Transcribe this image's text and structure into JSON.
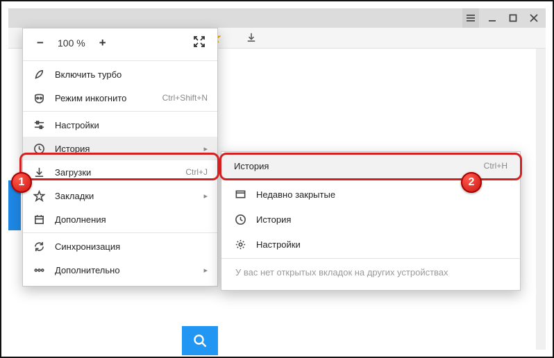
{
  "window": {
    "zoom": {
      "minus": "−",
      "value": "100 %",
      "plus": "+"
    }
  },
  "menu": {
    "turbo": "Включить турбо",
    "incognito": "Режим инкогнито",
    "incognito_sc": "Ctrl+Shift+N",
    "settings": "Настройки",
    "history": "История",
    "downloads": "Загрузки",
    "downloads_sc": "Ctrl+J",
    "bookmarks": "Закладки",
    "addons": "Дополнения",
    "sync": "Синхронизация",
    "more": "Дополнительно"
  },
  "submenu": {
    "history": "История",
    "history_sc": "Ctrl+H",
    "recent": "Недавно закрытые",
    "history2": "История",
    "settings": "Настройки",
    "note": "У вас нет открытых вкладок на других устройствах"
  },
  "badges": {
    "one": "1",
    "two": "2"
  }
}
